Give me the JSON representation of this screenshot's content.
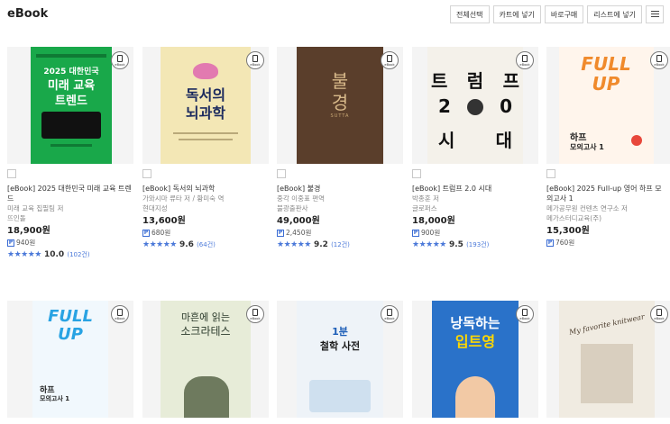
{
  "header": {
    "title": "eBook"
  },
  "toolbar": {
    "select_all": "전체선택",
    "add_cart": "카트에 넣기",
    "buy_now": "바로구매",
    "add_list": "리스트에 넣기"
  },
  "badge_text": "eBook",
  "row1": [
    {
      "title": "[eBook] 2025 대한민국 미래 교육 트렌드",
      "author": "미래 교육 집필팀 저",
      "publisher": "뜨인돌",
      "price": "18,900원",
      "points": "940원",
      "stars": "★★★★★",
      "rating": "10.0",
      "count": "(102건)",
      "cover_text": [
        "2025 대한민국",
        "미래 교육",
        "트렌드"
      ],
      "cover_color": "#19a84a"
    },
    {
      "title": "[eBook] 독서의 뇌과학",
      "author": "가와시마 류타 저 / 황미숙 역",
      "publisher": "현대지성",
      "price": "13,600원",
      "points": "680원",
      "stars": "★★★★★",
      "rating": "9.6",
      "count": "(64건)",
      "cover_text": [
        "독서의",
        "뇌과학"
      ],
      "cover_color": "#f3e7b5"
    },
    {
      "title": "[eBook] 불경",
      "author": "중각 이중표 편역",
      "publisher": "불광출판사",
      "price": "49,000원",
      "points": "2,450원",
      "stars": "★★★★★",
      "rating": "9.2",
      "count": "(12건)",
      "cover_text": [
        "불",
        "경",
        "SUTTA"
      ],
      "cover_color": "#5a3e2b"
    },
    {
      "title": "[eBook] 트럼프 2.0 시대",
      "author": "박종훈 저",
      "publisher": "글로퍼스",
      "price": "18,000원",
      "points": "900원",
      "stars": "★★★★★",
      "rating": "9.5",
      "count": "(193건)",
      "cover_text": [
        "트",
        "럼",
        "프",
        "2",
        "0",
        "시",
        "대"
      ],
      "cover_color": "#f4f1ea"
    },
    {
      "title": "[eBook] 2025 Full-up 영어 하프 모의고사 1",
      "author": "메가공무원 컨텐츠 연구소 저",
      "publisher": "메가스터디교육(주)",
      "price": "15,300원",
      "points": "760원",
      "stars": "",
      "rating": "",
      "count": "",
      "cover_text": [
        "FULL",
        "UP",
        "하프",
        "모의고사 1"
      ],
      "cover_color": "#fff5ec"
    }
  ],
  "row2": [
    {
      "cover_text": [
        "FULL",
        "UP",
        "하프",
        "모의고사 1"
      ],
      "cover_color": "#f1f8fd"
    },
    {
      "cover_text": [
        "마흔에 읽는",
        "소크라테스"
      ],
      "cover_color": "#e7ecd8"
    },
    {
      "cover_text": [
        "1분",
        "철학 사전"
      ],
      "cover_color": "#eef3f8"
    },
    {
      "cover_text": [
        "낭독하는",
        "입트영"
      ],
      "cover_color": "#2a72c9"
    },
    {
      "cover_text": [
        "My favorite knitwear"
      ],
      "cover_color": "#f0ebe1"
    }
  ]
}
